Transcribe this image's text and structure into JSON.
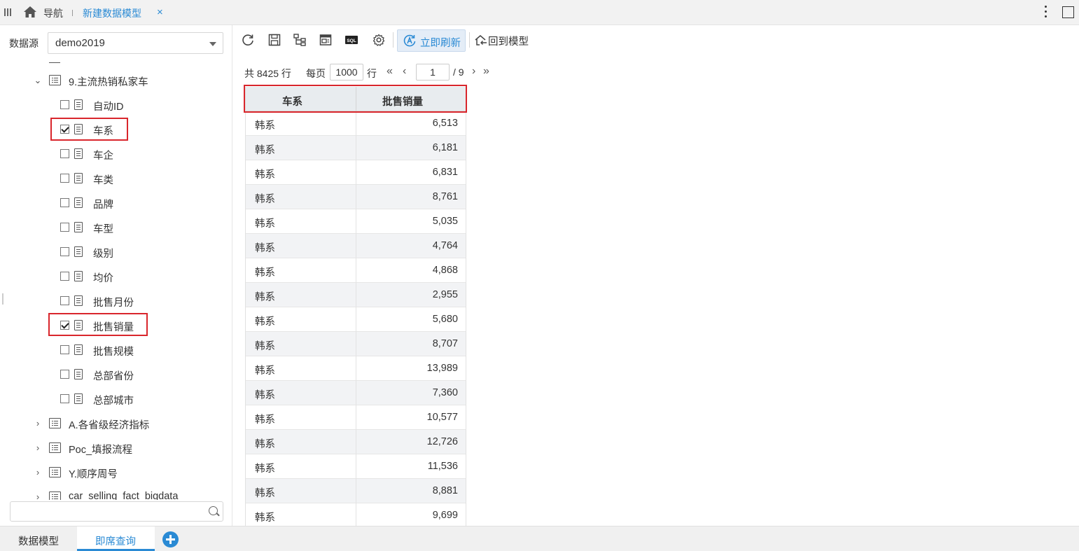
{
  "topbar": {
    "nav_label": "导航",
    "tab_title": "新建数据模型",
    "tab_close": "×"
  },
  "datasource": {
    "label": "数据源",
    "value": "demo2019"
  },
  "tree": {
    "table": "9.主流热销私家车",
    "fields": [
      {
        "label": "自动ID",
        "checked": false
      },
      {
        "label": "车系",
        "checked": true
      },
      {
        "label": "车企",
        "checked": false
      },
      {
        "label": "车类",
        "checked": false
      },
      {
        "label": "品牌",
        "checked": false
      },
      {
        "label": "车型",
        "checked": false
      },
      {
        "label": "级别",
        "checked": false
      },
      {
        "label": "均价",
        "checked": false
      },
      {
        "label": "批售月份",
        "checked": false
      },
      {
        "label": "批售销量",
        "checked": true
      },
      {
        "label": "批售规模",
        "checked": false
      },
      {
        "label": "总部省份",
        "checked": false
      },
      {
        "label": "总部城市",
        "checked": false
      }
    ],
    "other_tables": [
      "A.各省级经济指标",
      "Poc_填报流程",
      "Y.顺序周号",
      "car_selling_fact_bigdata"
    ]
  },
  "search": {
    "placeholder": ""
  },
  "toolbar": {
    "refresh_now": "立即刷新",
    "back_to_model": "回到模型",
    "sql_label": "SQL"
  },
  "pager": {
    "total": "共 8425 行",
    "per_page_label": "每页",
    "per_page": "1000",
    "row_label": "行",
    "first": "«",
    "prev": "‹",
    "page": "1",
    "next": "›",
    "last": "»",
    "page_total": "/ 9"
  },
  "grid": {
    "columns": [
      "车系",
      "批售销量"
    ],
    "rows": [
      [
        "韩系",
        "6,513"
      ],
      [
        "韩系",
        "6,181"
      ],
      [
        "韩系",
        "6,831"
      ],
      [
        "韩系",
        "8,761"
      ],
      [
        "韩系",
        "5,035"
      ],
      [
        "韩系",
        "4,764"
      ],
      [
        "韩系",
        "4,868"
      ],
      [
        "韩系",
        "2,955"
      ],
      [
        "韩系",
        "5,680"
      ],
      [
        "韩系",
        "8,707"
      ],
      [
        "韩系",
        "13,989"
      ],
      [
        "韩系",
        "7,360"
      ],
      [
        "韩系",
        "10,577"
      ],
      [
        "韩系",
        "12,726"
      ],
      [
        "韩系",
        "11,536"
      ],
      [
        "韩系",
        "8,881"
      ],
      [
        "韩系",
        "9,699"
      ]
    ]
  },
  "bottom_tabs": {
    "model": "数据模型",
    "query": "即席查询"
  },
  "colors": {
    "accent": "#2a8ad4",
    "highlight": "#d9262c"
  }
}
